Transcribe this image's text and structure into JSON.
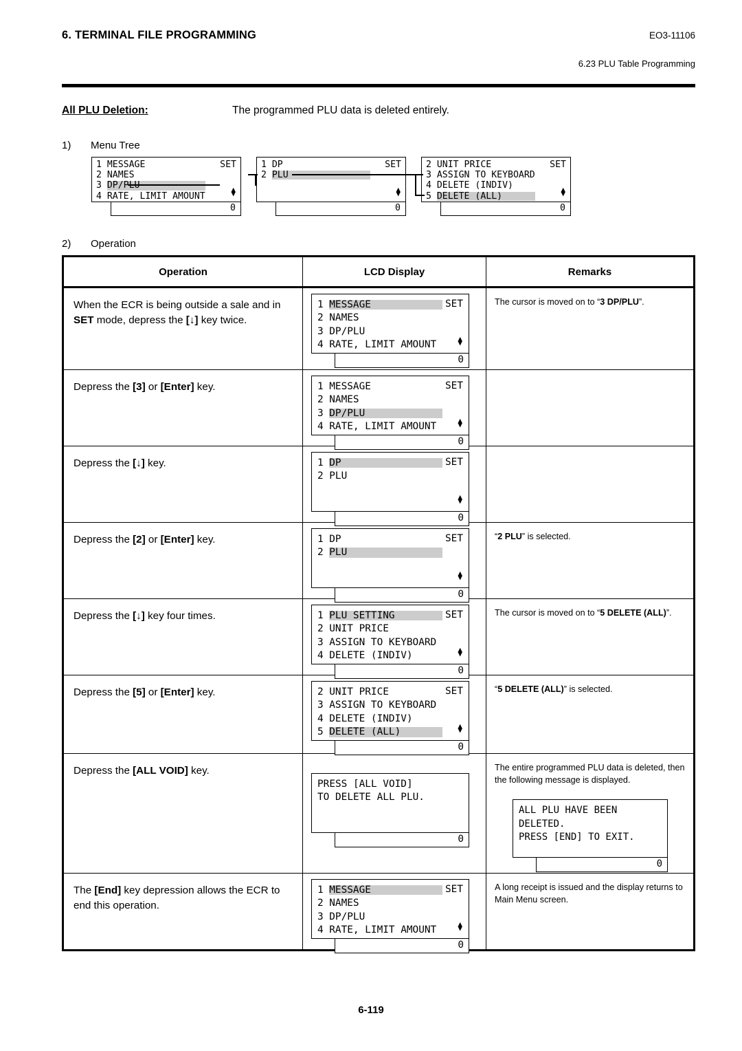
{
  "header": {
    "chapter": "6. TERMINAL FILE PROGRAMMING",
    "doc_number": "EO3-11106",
    "section": "6.23 PLU Table Programming"
  },
  "title": {
    "label": "All PLU Deletion:",
    "description": "The programmed PLU data is deleted entirely."
  },
  "sections": {
    "menu_tree": {
      "num": "1)",
      "label": "Menu Tree"
    },
    "operation": {
      "num": "2)",
      "label": "Operation"
    }
  },
  "menu_tree_boxes": [
    {
      "name": "menu-tree-box-1",
      "lines": [
        {
          "index": "1",
          "text": "MESSAGE",
          "highlight": false,
          "right": "SET"
        },
        {
          "index": "2",
          "text": "NAMES",
          "highlight": false,
          "right": ""
        },
        {
          "index": "3",
          "text": "DP/PLU",
          "highlight": true,
          "right": ""
        },
        {
          "index": "4",
          "text": "RATE, LIMIT AMOUNT",
          "highlight": false,
          "right": ""
        }
      ],
      "arrows": true,
      "value": "0"
    },
    {
      "name": "menu-tree-box-2",
      "lines": [
        {
          "index": "1",
          "text": "DP",
          "highlight": false,
          "right": "SET"
        },
        {
          "index": "2",
          "text": "PLU",
          "highlight": true,
          "right": ""
        },
        {
          "index": "",
          "text": "",
          "highlight": false,
          "right": ""
        },
        {
          "index": "",
          "text": "",
          "highlight": false,
          "right": ""
        }
      ],
      "arrows": true,
      "value": "0"
    },
    {
      "name": "menu-tree-box-3",
      "lines": [
        {
          "index": "2",
          "text": "UNIT PRICE",
          "highlight": false,
          "right": "SET"
        },
        {
          "index": "3",
          "text": "ASSIGN TO KEYBOARD",
          "highlight": false,
          "right": ""
        },
        {
          "index": "4",
          "text": "DELETE (INDIV)",
          "highlight": false,
          "right": ""
        },
        {
          "index": "5",
          "text": "DELETE (ALL)",
          "highlight": true,
          "right": ""
        }
      ],
      "arrows": true,
      "value": "0"
    }
  ],
  "table": {
    "headers": {
      "operation": "Operation",
      "lcd_display": "LCD Display",
      "remarks": "Remarks"
    },
    "rows": [
      {
        "name": "row-set-mode",
        "operation_html": "When the ECR is being outside a sale and in <b>SET</b> mode, depress the <b>[↓]</b> key twice.",
        "lcd": {
          "lines": [
            {
              "index": "1",
              "text": "MESSAGE",
              "highlight": true,
              "right": "SET"
            },
            {
              "index": "2",
              "text": "NAMES",
              "highlight": false,
              "right": ""
            },
            {
              "index": "3",
              "text": "DP/PLU",
              "highlight": false,
              "right": ""
            },
            {
              "index": "4",
              "text": "RATE, LIMIT AMOUNT",
              "highlight": false,
              "right": ""
            }
          ],
          "arrows": true,
          "value": "0"
        },
        "remark_html": "The cursor is moved on to “<b>3 DP/PLU</b>”."
      },
      {
        "name": "row-press-3",
        "operation_html": "Depress the <b>[3]</b> or <b>[Enter]</b> key.",
        "lcd": {
          "lines": [
            {
              "index": "1",
              "text": "MESSAGE",
              "highlight": false,
              "right": "SET"
            },
            {
              "index": "2",
              "text": "NAMES",
              "highlight": false,
              "right": ""
            },
            {
              "index": "3",
              "text": "DP/PLU",
              "highlight": true,
              "right": ""
            },
            {
              "index": "4",
              "text": "RATE, LIMIT AMOUNT",
              "highlight": false,
              "right": ""
            }
          ],
          "arrows": true,
          "value": "0"
        },
        "remark_html": ""
      },
      {
        "name": "row-press-down",
        "operation_html": "Depress the <b>[↓]</b> key.",
        "lcd": {
          "lines": [
            {
              "index": "1",
              "text": "DP",
              "highlight": true,
              "right": "SET"
            },
            {
              "index": "2",
              "text": "PLU",
              "highlight": false,
              "right": ""
            },
            {
              "index": "",
              "text": "",
              "highlight": false,
              "right": ""
            },
            {
              "index": "",
              "text": "",
              "highlight": false,
              "right": ""
            }
          ],
          "arrows": true,
          "value": "0"
        },
        "remark_html": ""
      },
      {
        "name": "row-press-2",
        "operation_html": "Depress the <b>[2]</b> or <b>[Enter]</b> key.",
        "lcd": {
          "lines": [
            {
              "index": "1",
              "text": "DP",
              "highlight": false,
              "right": "SET"
            },
            {
              "index": "2",
              "text": "PLU",
              "highlight": true,
              "right": ""
            },
            {
              "index": "",
              "text": "",
              "highlight": false,
              "right": ""
            },
            {
              "index": "",
              "text": "",
              "highlight": false,
              "right": ""
            }
          ],
          "arrows": true,
          "value": "0"
        },
        "remark_html": "“<b>2 PLU</b>” is selected."
      },
      {
        "name": "row-press-down-four",
        "operation_html": "Depress the <b>[↓]</b> key four times.",
        "lcd": {
          "lines": [
            {
              "index": "1",
              "text": "PLU SETTING",
              "highlight": true,
              "right": "SET"
            },
            {
              "index": "2",
              "text": "UNIT PRICE",
              "highlight": false,
              "right": ""
            },
            {
              "index": "3",
              "text": "ASSIGN TO KEYBOARD",
              "highlight": false,
              "right": ""
            },
            {
              "index": "4",
              "text": "DELETE (INDIV)",
              "highlight": false,
              "right": ""
            }
          ],
          "arrows": true,
          "value": "0"
        },
        "remark_html": "The cursor is moved on to “<b>5 DELETE (ALL)</b>”."
      },
      {
        "name": "row-press-5",
        "operation_html": "Depress the <b>[5]</b> or <b>[Enter]</b> key.",
        "lcd": {
          "lines": [
            {
              "index": "2",
              "text": "UNIT PRICE",
              "highlight": false,
              "right": "SET"
            },
            {
              "index": "3",
              "text": "ASSIGN TO KEYBOARD",
              "highlight": false,
              "right": ""
            },
            {
              "index": "4",
              "text": "DELETE (INDIV)",
              "highlight": false,
              "right": ""
            },
            {
              "index": "5",
              "text": "DELETE (ALL)",
              "highlight": true,
              "right": ""
            }
          ],
          "arrows": true,
          "value": "0"
        },
        "remark_html": "“<b>5 DELETE (ALL)</b>” is selected."
      },
      {
        "name": "row-press-all-void",
        "operation_html": "Depress the <b>[ALL VOID]</b> key.",
        "lcd": {
          "message_lines": [
            "PRESS [ALL VOID]",
            "TO DELETE ALL PLU."
          ],
          "arrows": false,
          "value": "0"
        },
        "remark_html": "The entire programmed PLU data is deleted, then the following message is displayed.",
        "remark_lcd": {
          "message_lines": [
            "ALL PLU HAVE BEEN",
            "DELETED.",
            "PRESS [END] TO EXIT."
          ],
          "value": "0"
        }
      },
      {
        "name": "row-press-end",
        "operation_html": "The <b>[End]</b> key depression allows the ECR to end this operation.",
        "lcd": {
          "lines": [
            {
              "index": "1",
              "text": "MESSAGE",
              "highlight": true,
              "right": "SET"
            },
            {
              "index": "2",
              "text": "NAMES",
              "highlight": false,
              "right": ""
            },
            {
              "index": "3",
              "text": "DP/PLU",
              "highlight": false,
              "right": ""
            },
            {
              "index": "4",
              "text": "RATE, LIMIT AMOUNT",
              "highlight": false,
              "right": ""
            }
          ],
          "arrows": true,
          "value": "0"
        },
        "remark_html": "A long receipt is issued and the display returns to Main Menu screen."
      }
    ]
  },
  "footer": {
    "page_number": "6-119"
  },
  "colors": {
    "highlight": "#cccccc",
    "ink": "#000000",
    "paper": "#ffffff"
  }
}
